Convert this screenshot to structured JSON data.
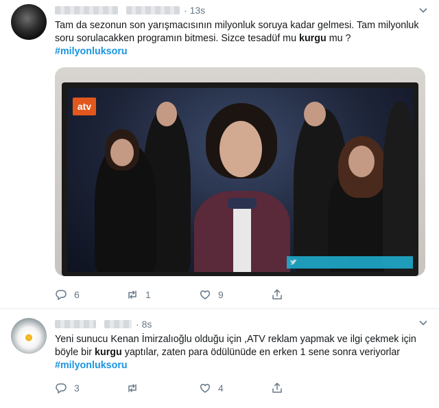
{
  "tweets": [
    {
      "time": "13s",
      "text_parts": {
        "t1": "Tam da sezonun son yarışmacısının milyonluk soruya kadar gelmesi. Tam milyonluk soru sorulacakken programın bitmesi. Sizce tesadüf mu ",
        "kw": "kurgu",
        "t2": " mu ? ",
        "tag": "#milyonluksoru"
      },
      "media": {
        "logo": "atv"
      },
      "actions": {
        "replies": "6",
        "retweets": "1",
        "likes": "9"
      }
    },
    {
      "time": "8s",
      "text_parts": {
        "t1": "Yeni sunucu Kenan İmirzalıoğlu olduğu için ,ATV reklam yapmak ve ilgi çekmek için böyle bir ",
        "kw": "kurgu",
        "t2": " yaptılar, zaten para ödülünüde en erken 1 sene sonra veriyorlar ",
        "tag": "#milyonluksoru"
      },
      "actions": {
        "replies": "3",
        "retweets": "",
        "likes": "4"
      }
    }
  ],
  "icons": [
    "reply-icon",
    "retweet-icon",
    "like-icon",
    "share-icon",
    "caret-down-icon"
  ],
  "colors": {
    "hashtag": "#1b95e0",
    "muted": "#657786",
    "divider": "#e6ecf0"
  }
}
